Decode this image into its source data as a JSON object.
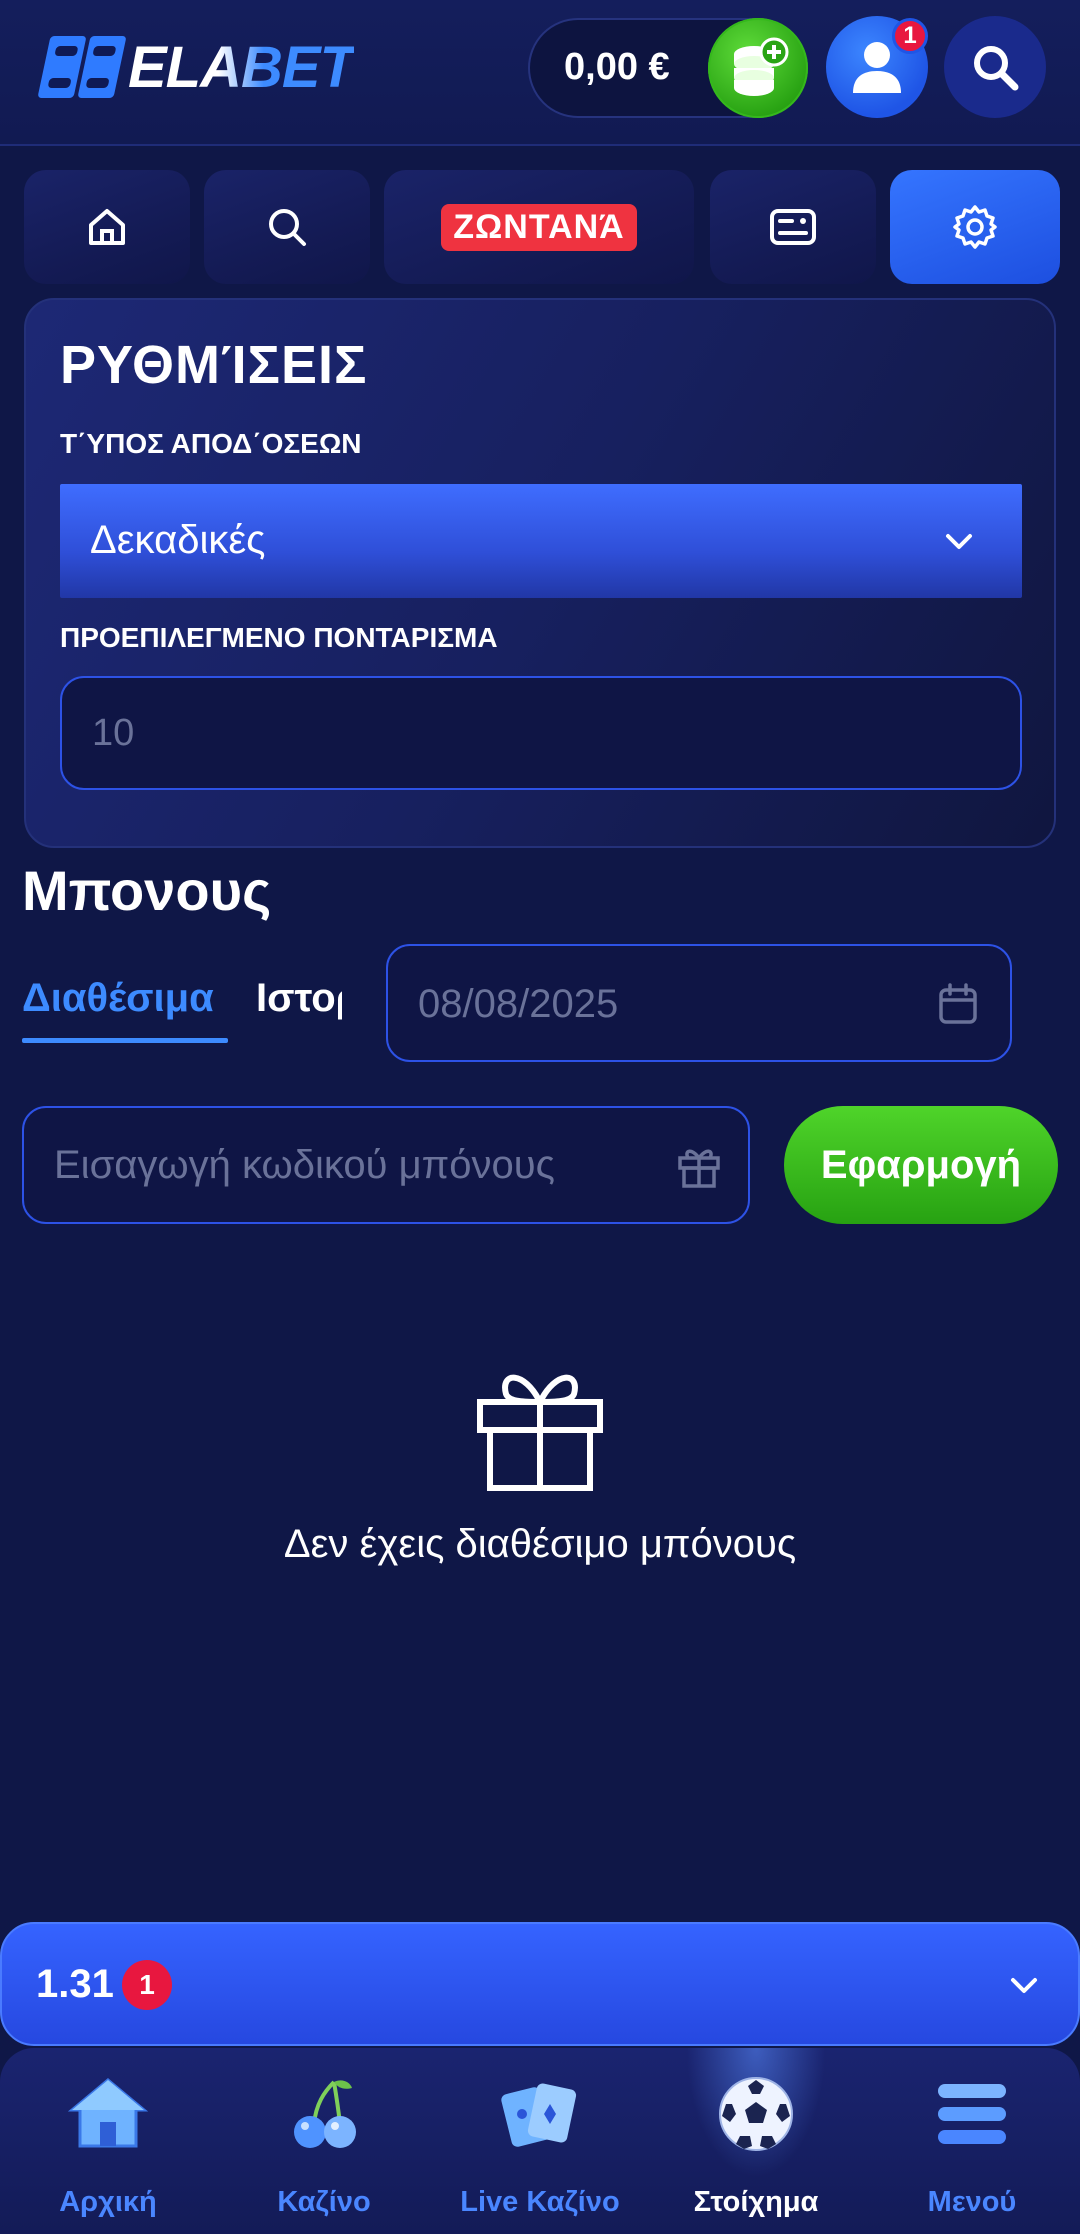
{
  "header": {
    "logo_text": "ELABET",
    "balance": "0,00 €",
    "notifications_count": "1"
  },
  "nav": {
    "live_label": "ΖΩΝΤΑΝΆ"
  },
  "settings": {
    "title": "ΡΥΘΜΊΣΕΙΣ",
    "odds_type_label": "Τ΄ΥΠΟΣ ΑΠΟΔ΄ΟΣΕΩΝ",
    "odds_type_value": "Δεκαδικές",
    "default_stake_label": "ΠΡΟΕΠΙΛΕΓΜΕΝΟ ΠΟΝΤΑΡΙΣΜΑ",
    "default_stake_value": "10"
  },
  "bonus": {
    "title": "Μπονους",
    "tabs": [
      {
        "label": "Διαθέσιμα",
        "active": true
      },
      {
        "label": "Ιστορικό",
        "active": false
      }
    ],
    "date_value": "08/08/2025",
    "code_placeholder": "Εισαγωγή κωδικού μπόνους",
    "apply_label": "Εφαρμογή",
    "empty_message": "Δεν έχεις διαθέσιμο μπόνους"
  },
  "betslip": {
    "odds": "1.31",
    "count": "1"
  },
  "bottom_nav": [
    {
      "label": "Αρχική",
      "icon": "house-icon"
    },
    {
      "label": "Καζίνο",
      "icon": "cherries-icon"
    },
    {
      "label": "Live Καζίνο",
      "icon": "cards-icon"
    },
    {
      "label": "Στοίχημα",
      "icon": "soccer-ball-icon",
      "active": true
    },
    {
      "label": "Μενού",
      "icon": "menu-icon"
    }
  ],
  "colors": {
    "background": "#0f1747",
    "accent_blue": "#3d8bff",
    "green": "#2aa414",
    "live_red": "#ef3340",
    "badge_red": "#e8173f"
  }
}
